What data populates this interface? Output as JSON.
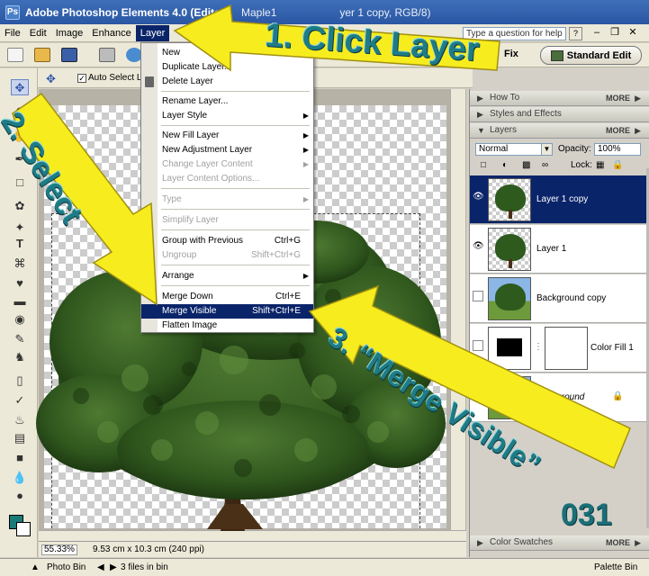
{
  "titlebar": {
    "app_title": "Adobe Photoshop Elements 4.0 (Editor)",
    "doc_name": "Maple1",
    "doc_tail": "yer 1 copy, RGB/8)"
  },
  "menubar": {
    "items": [
      "File",
      "Edit",
      "Image",
      "Enhance",
      "Layer"
    ],
    "help_placeholder": "Type a question for help",
    "help_button": "?"
  },
  "shortcuts": {
    "quick_fix_label": "Fix",
    "standard_edit_label": "Standard Edit"
  },
  "options_bar": {
    "auto_select_label": "Auto Select La"
  },
  "layer_menu": {
    "items": [
      {
        "label": "New",
        "shortcut": "",
        "submenu": true,
        "disabled": false
      },
      {
        "label": "Duplicate Layer...",
        "shortcut": "",
        "submenu": false,
        "disabled": false
      },
      {
        "label": "Delete Layer",
        "shortcut": "",
        "submenu": false,
        "disabled": false
      },
      {
        "label": "Rename Layer...",
        "shortcut": "",
        "submenu": false,
        "disabled": false
      },
      {
        "label": "Layer Style",
        "shortcut": "",
        "submenu": true,
        "disabled": false
      },
      {
        "label": "New Fill Layer",
        "shortcut": "",
        "submenu": true,
        "disabled": false
      },
      {
        "label": "New Adjustment Layer",
        "shortcut": "",
        "submenu": true,
        "disabled": false
      },
      {
        "label": "Change Layer Content",
        "shortcut": "",
        "submenu": true,
        "disabled": true
      },
      {
        "label": "Layer Content Options...",
        "shortcut": "",
        "submenu": false,
        "disabled": true
      },
      {
        "label": "Type",
        "shortcut": "",
        "submenu": true,
        "disabled": true
      },
      {
        "label": "Simplify Layer",
        "shortcut": "",
        "submenu": false,
        "disabled": true
      },
      {
        "label": "Group with Previous",
        "shortcut": "Ctrl+G",
        "submenu": false,
        "disabled": false
      },
      {
        "label": "Ungroup",
        "shortcut": "Shift+Ctrl+G",
        "submenu": false,
        "disabled": true
      },
      {
        "label": "Arrange",
        "shortcut": "",
        "submenu": true,
        "disabled": false
      },
      {
        "label": "Merge Down",
        "shortcut": "Ctrl+E",
        "submenu": false,
        "disabled": false
      },
      {
        "label": "Merge Visible",
        "shortcut": "Shift+Ctrl+E",
        "submenu": false,
        "disabled": false,
        "highlighted": true
      },
      {
        "label": "Flatten Image",
        "shortcut": "",
        "submenu": false,
        "disabled": false
      }
    ]
  },
  "palette_bin": {
    "how_to": "How To",
    "styles_effects": "Styles and Effects",
    "layers": "Layers",
    "more": "MORE",
    "blend_mode": "Normal",
    "opacity_label": "Opacity:",
    "opacity_value": "100%",
    "lock_label": "Lock:",
    "layer_list": [
      {
        "name": "Layer 1 copy",
        "selected": true,
        "visible": true
      },
      {
        "name": "Layer 1",
        "selected": false,
        "visible": true
      },
      {
        "name": "Background copy",
        "selected": false,
        "visible": false
      },
      {
        "name": "Color Fill 1",
        "selected": false,
        "visible": false
      },
      {
        "name": "Background",
        "selected": false,
        "visible": false
      }
    ],
    "color_swatches": "Color Swatches"
  },
  "status": {
    "zoom": "55.33%",
    "doc_size": "9.53 cm x 10.3 cm (240 ppi)"
  },
  "bin_bar": {
    "photo_bin": "Photo Bin",
    "files_in_bin": "3 files in bin",
    "palette_bin": "Palette Bin"
  },
  "callouts": {
    "step1": "1. Click Layer",
    "step2": "2. Select",
    "step3": "3. “Merge Visible”",
    "badge": "031",
    "color": "#f7ec1e"
  }
}
